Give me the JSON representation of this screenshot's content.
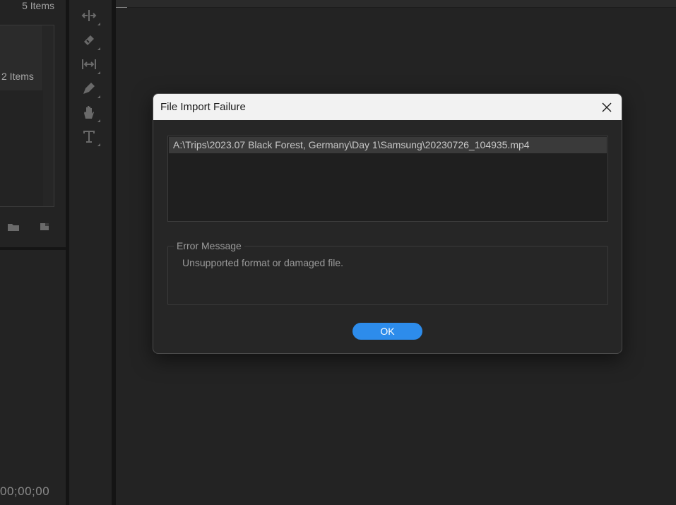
{
  "project_panel": {
    "items_count_top": "5 Items",
    "items_count_bin": "2 Items",
    "timecode": "00;00;00",
    "bottom_icons": [
      "folder-icon",
      "new-item-icon"
    ]
  },
  "tools": [
    "ripple-edit-icon",
    "razor-icon",
    "slip-icon",
    "pen-icon",
    "hand-icon",
    "type-icon"
  ],
  "dialog": {
    "title": "File Import Failure",
    "close_icon": "close-icon",
    "files": [
      "A:\\Trips\\2023.07 Black Forest, Germany\\Day 1\\Samsung\\20230726_104935.mp4"
    ],
    "error_group_label": "Error Message",
    "error_text": "Unsupported format or damaged file.",
    "ok_label": "OK"
  },
  "colors": {
    "accent": "#2d8ceb",
    "background": "#232323",
    "titlebar": "#f2f2f2",
    "selected_row": "#3a3a3a"
  }
}
